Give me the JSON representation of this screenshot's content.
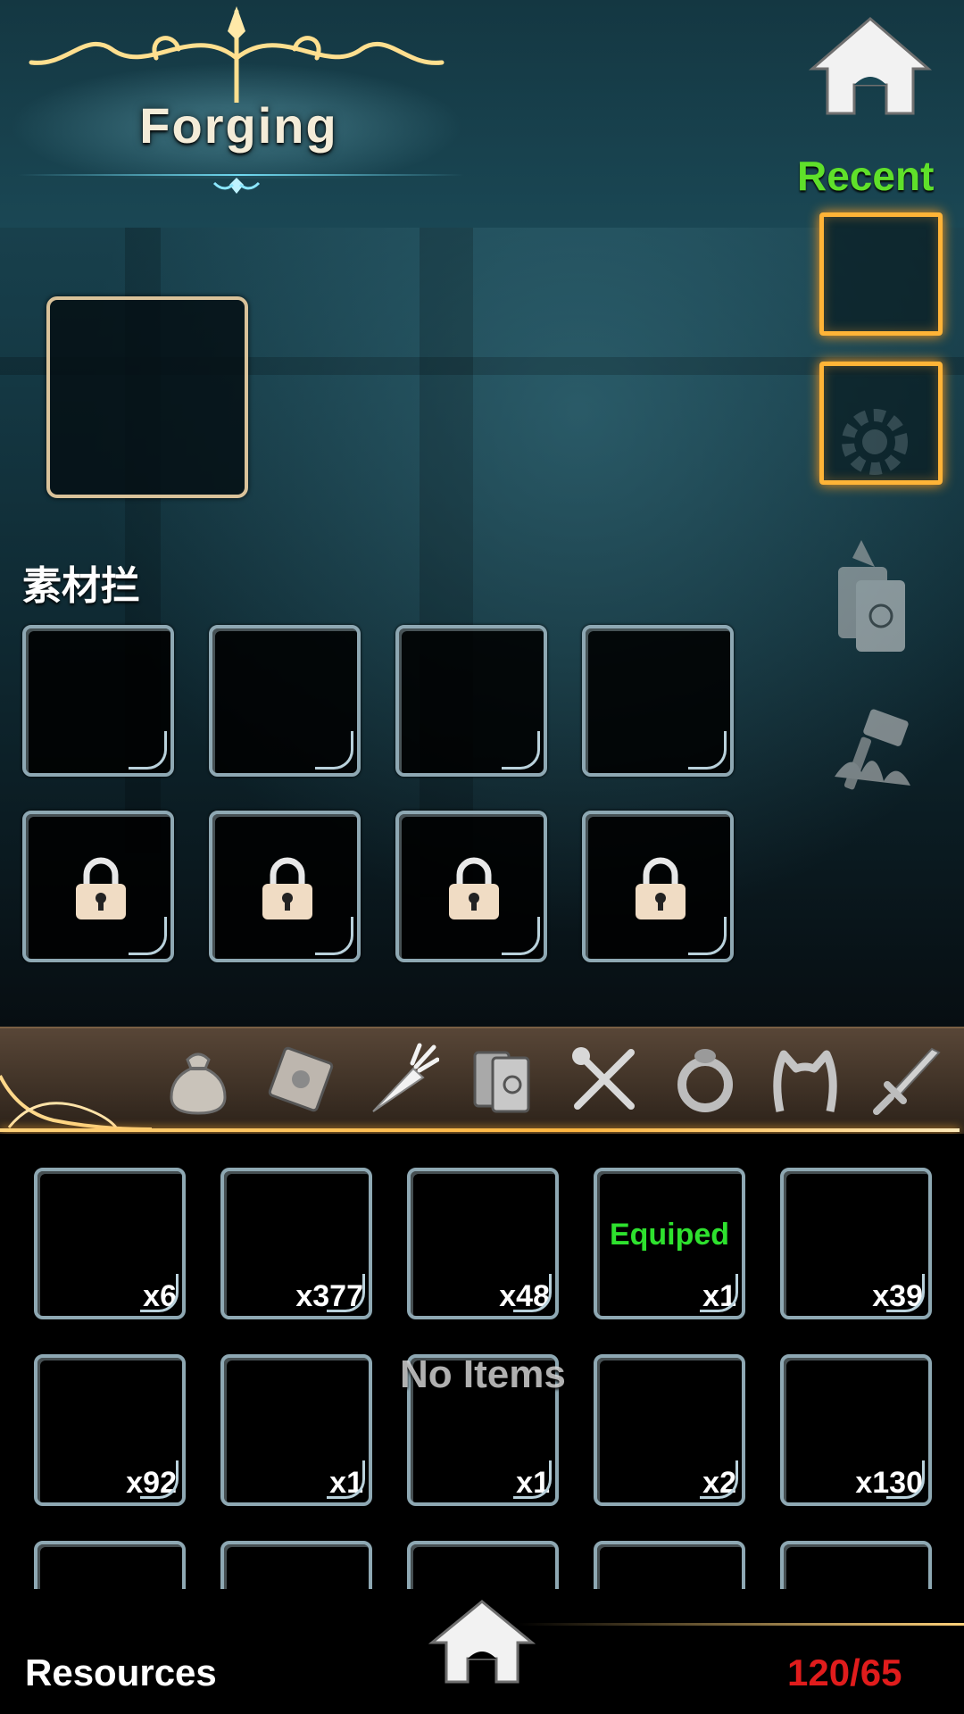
{
  "header": {
    "title": "Forging"
  },
  "recent": {
    "label": "Recent"
  },
  "materials": {
    "label": "素材拦"
  },
  "categories": [
    "bag-icon",
    "scroll-icon",
    "carrot-icon",
    "books-icon",
    "utensils-icon",
    "ring-icon",
    "headband-icon",
    "sword-icon"
  ],
  "inventory": {
    "empty_text": "No Items",
    "items": [
      {
        "count": "x6",
        "status": ""
      },
      {
        "count": "x377",
        "status": ""
      },
      {
        "count": "x48",
        "status": ""
      },
      {
        "count": "x1",
        "status": "Equiped"
      },
      {
        "count": "x39",
        "status": ""
      },
      {
        "count": "x92",
        "status": ""
      },
      {
        "count": "x1",
        "status": ""
      },
      {
        "count": "x1",
        "status": ""
      },
      {
        "count": "x2",
        "status": ""
      },
      {
        "count": "x130",
        "status": ""
      }
    ]
  },
  "footer": {
    "tab_label": "Resources",
    "capacity": "120/65"
  },
  "colors": {
    "accent_green": "#5fe02a",
    "equipped_green": "#2ee12e",
    "capacity_red": "#e01c1c",
    "gold": "#ffb437"
  }
}
